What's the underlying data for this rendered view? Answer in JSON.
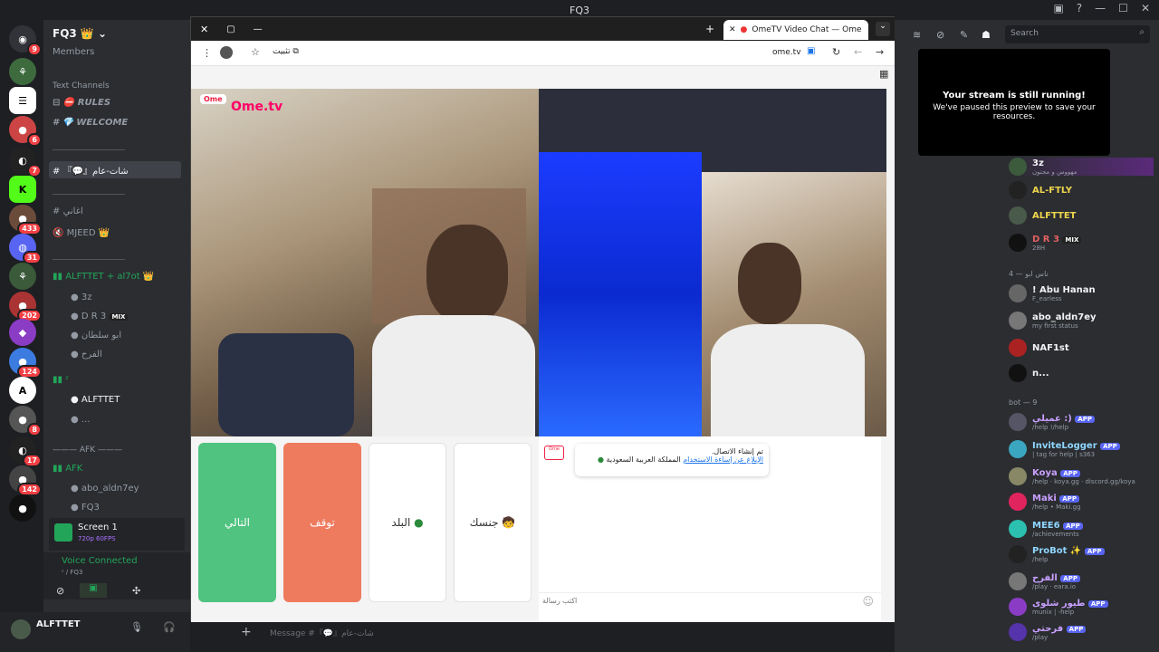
{
  "window": {
    "title": "FQ3"
  },
  "server": {
    "name": "FQ3",
    "badges": [
      "9",
      "6",
      "7",
      "433",
      "31",
      "202",
      "124",
      "8",
      "8",
      "17",
      "142"
    ]
  },
  "channels": {
    "members_label": "Members",
    "text_channels_label": "Text Channels",
    "rules": "RULES",
    "welcome": "WELCOME",
    "general": "『💬』شات-عام",
    "a3ani": "اغاني",
    "mjeed": "MJEED",
    "voice1_title": "ALFTTET + al7ot",
    "voice1_users": [
      "3z",
      "D R 3",
      "ابو سلطان",
      "الفرح"
    ],
    "mix_tag": "MIX",
    "voice2_title": "ᶻ",
    "voice2_users": [
      "ALFTTET",
      "..."
    ],
    "afk_category": "AFK",
    "afk_title": "AFK",
    "afk_users": [
      "abo_aldn7ey",
      "FQ3"
    ]
  },
  "screen_share": {
    "title": "Screen 1",
    "sub": "720p 60FPS"
  },
  "voice_status": {
    "title": "Voice Connected",
    "sub": "ᶻ / FQ3"
  },
  "user_panel": {
    "name": "ALFTTET"
  },
  "browser": {
    "tab_title": "OmeTV Video Chat — Ome",
    "address": "ome.tv",
    "pin_label": "تثبيت",
    "logo_text": "Ome.tv"
  },
  "ometv": {
    "next_label": "التالي",
    "stop_label": "توقف",
    "country_label": "البلد",
    "gender_label": "جنسك",
    "chat_line1": "تم إنشاء الاتصال.",
    "chat_report": "الإبلاغ عن إساءة الاستخدام",
    "chat_country": "المملكة العربية السعودية",
    "chat_placeholder": "اكتب رسالة",
    "colors": {
      "next": "#4fc37f",
      "stop": "#ee7b5e"
    }
  },
  "search": {
    "placeholder": "Search"
  },
  "stream_notice": {
    "title": "Your stream is still running!",
    "body": "We've paused this preview to save your resources."
  },
  "members": {
    "online": [
      {
        "name": "3z",
        "sub": "مهووس و مجنون"
      },
      {
        "name": "AL-FTLY",
        "sub": ""
      },
      {
        "name": "ALFTTET",
        "sub": ""
      },
      {
        "name": "D R 3",
        "sub": "28H",
        "tag": "MIX"
      }
    ],
    "group2": "ناس ابو — 4",
    "group2_members": [
      {
        "name": "! Abu Hanan",
        "sub": "F_earless"
      },
      {
        "name": "abo_aldn7ey",
        "sub": "my first status"
      },
      {
        "name": "NAF1st",
        "sub": ""
      },
      {
        "name": "n...",
        "sub": ""
      }
    ],
    "bots_label": "bot — 9",
    "bots": [
      {
        "name": "عميلي :)",
        "sub": "/help !/help"
      },
      {
        "name": "InviteLogger",
        "sub": "| tag for help | s363"
      },
      {
        "name": "Koya",
        "sub": "/help · koya.gg · discord.gg/koya"
      },
      {
        "name": "Maki",
        "sub": "/help • Maki.gg"
      },
      {
        "name": "MEE6",
        "sub": "/achievements"
      },
      {
        "name": "ProBot",
        "sub": "/help"
      },
      {
        "name": "الفرح",
        "sub": "/play · eara.io"
      },
      {
        "name": "طيور شلوى",
        "sub": "munix | -help"
      },
      {
        "name": "فرحتي",
        "sub": "/play"
      }
    ],
    "app_tag": "APP"
  },
  "message_placeholder": "Message #『💬』شات-عام"
}
